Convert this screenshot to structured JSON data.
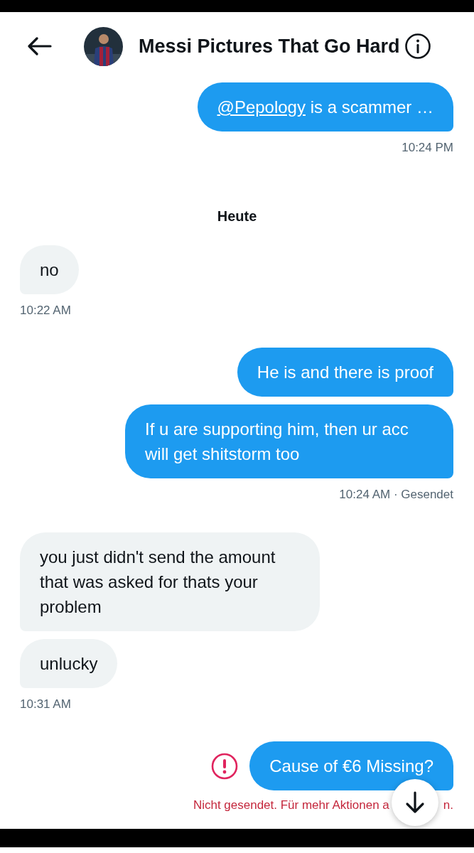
{
  "header": {
    "title": "Messi Pictures That Go Hard"
  },
  "messages": [
    {
      "kind": "bubble",
      "outgoing": true,
      "parts": [
        {
          "text": "@Pepology",
          "link": true
        },
        {
          "text": " is a scammer …",
          "link": false
        }
      ]
    },
    {
      "kind": "time",
      "outgoing": true,
      "text": "10:24 PM"
    },
    {
      "kind": "date",
      "text": "Heute"
    },
    {
      "kind": "bubble",
      "outgoing": false,
      "parts": [
        {
          "text": "no",
          "link": false
        }
      ]
    },
    {
      "kind": "time",
      "outgoing": false,
      "text": "10:22 AM"
    },
    {
      "kind": "bubble",
      "outgoing": true,
      "parts": [
        {
          "text": "He is and there is proof",
          "link": false
        }
      ]
    },
    {
      "kind": "bubble",
      "outgoing": true,
      "parts": [
        {
          "text": "If u are supporting him, then ur acc will get shitstorm too",
          "link": false
        }
      ]
    },
    {
      "kind": "time",
      "outgoing": true,
      "text": "10:24 AM · Gesendet"
    },
    {
      "kind": "bubble",
      "outgoing": false,
      "parts": [
        {
          "text": "you just didn't send the amount that was asked for thats your problem",
          "link": false
        }
      ]
    },
    {
      "kind": "bubble",
      "outgoing": false,
      "parts": [
        {
          "text": "unlucky",
          "link": false
        }
      ]
    },
    {
      "kind": "time",
      "outgoing": false,
      "text": "10:31 AM"
    },
    {
      "kind": "bubble",
      "outgoing": true,
      "failed": true,
      "parts": [
        {
          "text": "Cause of €6 Missing?",
          "link": false
        }
      ]
    },
    {
      "kind": "error",
      "before": "Nicht gesendet. Für mehr Aktionen a",
      "after": "n."
    }
  ]
}
